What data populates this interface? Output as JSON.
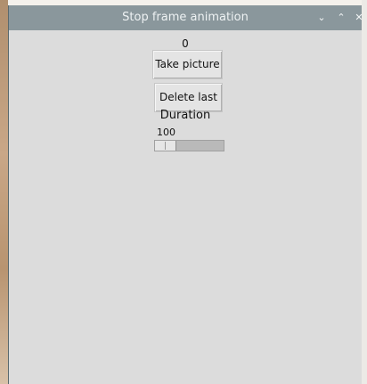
{
  "window": {
    "title": "Stop frame animation",
    "controls": {
      "minimize": "⌄",
      "maximize": "⌃",
      "close": "✕"
    }
  },
  "app": {
    "frame_count": "0",
    "take_picture_label": "Take picture",
    "delete_last_label": "Delete last",
    "duration_label": "Duration",
    "duration_value": "100"
  }
}
